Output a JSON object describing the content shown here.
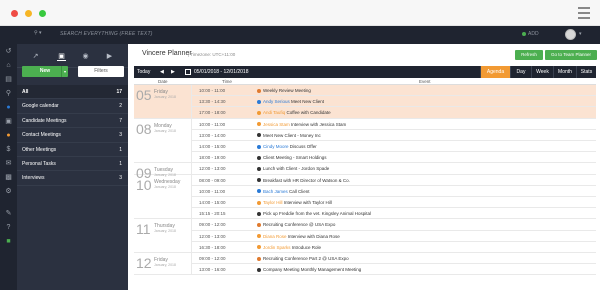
{
  "topbar": {
    "search_label": "SEARCH EVERYTHING (FREE TEXT)",
    "add_label": "ADD"
  },
  "sidebar": {
    "new_label": "New",
    "filters_label": "Filters",
    "items": [
      {
        "label": "All",
        "count": "17"
      },
      {
        "label": "Google calendar",
        "count": "2"
      },
      {
        "label": "Candidate Meetings",
        "count": "7"
      },
      {
        "label": "Contact Meetings",
        "count": "3"
      },
      {
        "label": "Other Meetings",
        "count": "1"
      },
      {
        "label": "Personal Tasks",
        "count": "1"
      },
      {
        "label": "Interviews",
        "count": "3"
      }
    ]
  },
  "header": {
    "title": "Vincere Planner",
    "timezone": "| Timezone: UTC+11:00",
    "refresh_label": "Refresh",
    "team_label": "Go to Team Planner"
  },
  "toolbar": {
    "today": "Today",
    "range": "05/01/2018 - 12/01/2018",
    "views": [
      "Agenda",
      "Day",
      "Week",
      "Month",
      "Stats"
    ]
  },
  "columns": {
    "date": "Date",
    "time": "Time",
    "event": "Event"
  },
  "days": [
    {
      "num": "05",
      "weekday": "Friday",
      "month": "January, 2018"
    },
    {
      "num": "08",
      "weekday": "Monday",
      "month": "January, 2018"
    },
    {
      "num": "09",
      "weekday": "Tuesday",
      "month": "January, 2018"
    },
    {
      "num": "10",
      "weekday": "Wednesday",
      "month": "January, 2018"
    },
    {
      "num": "11",
      "weekday": "Thursday",
      "month": "January, 2018"
    },
    {
      "num": "12",
      "weekday": "Friday",
      "month": "January, 2018"
    }
  ],
  "events": [
    {
      "time": "10:00 - 11:00",
      "who": "",
      "text": "Weekly Review Meeting",
      "color": "#e07a2e"
    },
    {
      "time": "13:30 - 14:30",
      "who": "Andy Serious",
      "text": "Meet New Client",
      "color": "#2a7ad6"
    },
    {
      "time": "17:00 - 18:00",
      "who": "Andi Taufiq",
      "text": "Coffee with Candidate",
      "color": "#f29a33"
    },
    {
      "time": "10:00 - 11:00",
      "who": "Jessica Stam",
      "text": "Interview with Jessica Stam",
      "color": "#f29a33"
    },
    {
      "time": "13:00 - 14:00",
      "who": "",
      "text": "Meet New Client - Money Inc",
      "color": "#333333"
    },
    {
      "time": "14:00 - 15:00",
      "who": "Cindy Moore",
      "text": "Discuss Offer",
      "color": "#2a7ad6"
    },
    {
      "time": "18:00 - 19:00",
      "who": "",
      "text": "Client Meeting - Smart Holdings",
      "color": "#333333"
    },
    {
      "time": "12:00 - 13:00",
      "who": "",
      "text": "Lunch with Client - Jordon Spade",
      "color": "#333333"
    },
    {
      "time": "08:00 - 09:00",
      "who": "",
      "text": "Breakfast with HR Director of Watson & Co.",
      "color": "#333333"
    },
    {
      "time": "10:00 - 11:00",
      "who": "Bach James",
      "text": "Call Client",
      "color": "#2a7ad6"
    },
    {
      "time": "14:00 - 15:00",
      "who": "Taylor Hill",
      "text": "Interview with Taylor Hill",
      "color": "#f29a33"
    },
    {
      "time": "15:15 - 20:15",
      "who": "",
      "text": "Pick up Freddie from the vet. Kingsley Animal Hospital",
      "color": "#333333"
    },
    {
      "time": "09:00 - 12:00",
      "who": "",
      "text": "Recruiting Conference @ USA Expo",
      "color": "#e07a2e"
    },
    {
      "time": "12:00 - 13:00",
      "who": "Diana Rose",
      "text": "Interview with Diana Rose",
      "color": "#f29a33"
    },
    {
      "time": "16:30 - 18:00",
      "who": "Jordin Sparks",
      "text": "Introduce Role",
      "color": "#f29a33"
    },
    {
      "time": "09:00 - 12:00",
      "who": "",
      "text": "Recruiting Conference Part 2 @ USA Expo",
      "color": "#e07a2e"
    },
    {
      "time": "13:00 - 16:00",
      "who": "",
      "text": "Company Meeting  Monthly Management Meeting",
      "color": "#333333"
    }
  ]
}
